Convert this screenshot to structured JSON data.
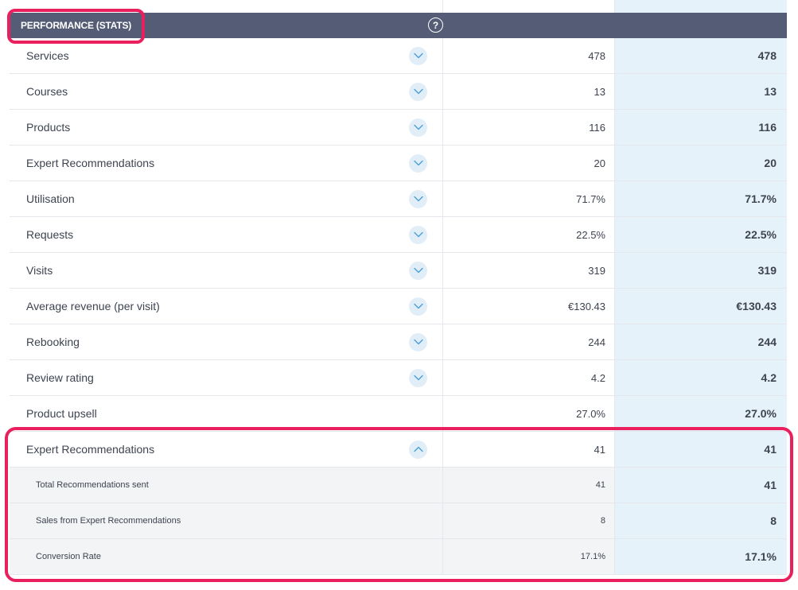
{
  "header": {
    "title": "PERFORMANCE (STATS)",
    "help_glyph": "?"
  },
  "rows": [
    {
      "label": "Services",
      "value": "478",
      "total": "478",
      "toggle": "down"
    },
    {
      "label": "Courses",
      "value": "13",
      "total": "13",
      "toggle": "down"
    },
    {
      "label": "Products",
      "value": "116",
      "total": "116",
      "toggle": "down"
    },
    {
      "label": "Expert Recommendations",
      "value": "20",
      "total": "20",
      "toggle": "down"
    },
    {
      "label": "Utilisation",
      "value": "71.7%",
      "total": "71.7%",
      "toggle": "down"
    },
    {
      "label": "Requests",
      "value": "22.5%",
      "total": "22.5%",
      "toggle": "down"
    },
    {
      "label": "Visits",
      "value": "319",
      "total": "319",
      "toggle": "down"
    },
    {
      "label": "Average revenue (per visit)",
      "value": "€130.43",
      "total": "€130.43",
      "toggle": "down"
    },
    {
      "label": "Rebooking",
      "value": "244",
      "total": "244",
      "toggle": "down"
    },
    {
      "label": "Review rating",
      "value": "4.2",
      "total": "4.2",
      "toggle": "down"
    },
    {
      "label": "Product upsell",
      "value": "27.0%",
      "total": "27.0%",
      "toggle": "none"
    }
  ],
  "expanded": {
    "label": "Expert Recommendations",
    "value": "41",
    "total": "41",
    "toggle": "up",
    "subrows": [
      {
        "label": "Total Recommendations sent",
        "value": "41",
        "total": "41"
      },
      {
        "label": "Sales from Expert Recommendations",
        "value": "8",
        "total": "8"
      },
      {
        "label": "Conversion Rate",
        "value": "17.1%",
        "total": "17.1%"
      }
    ]
  },
  "icons": {
    "expand": "chevron-down-icon",
    "collapse": "chevron-up-icon",
    "help": "question-circle-icon"
  },
  "colors": {
    "header_bg": "#545d75",
    "highlight": "#ea1f5e",
    "total_col_bg": "#e6f2f9",
    "chevron_bg": "#e1eef8",
    "chevron_stroke": "#4a9fd8"
  }
}
